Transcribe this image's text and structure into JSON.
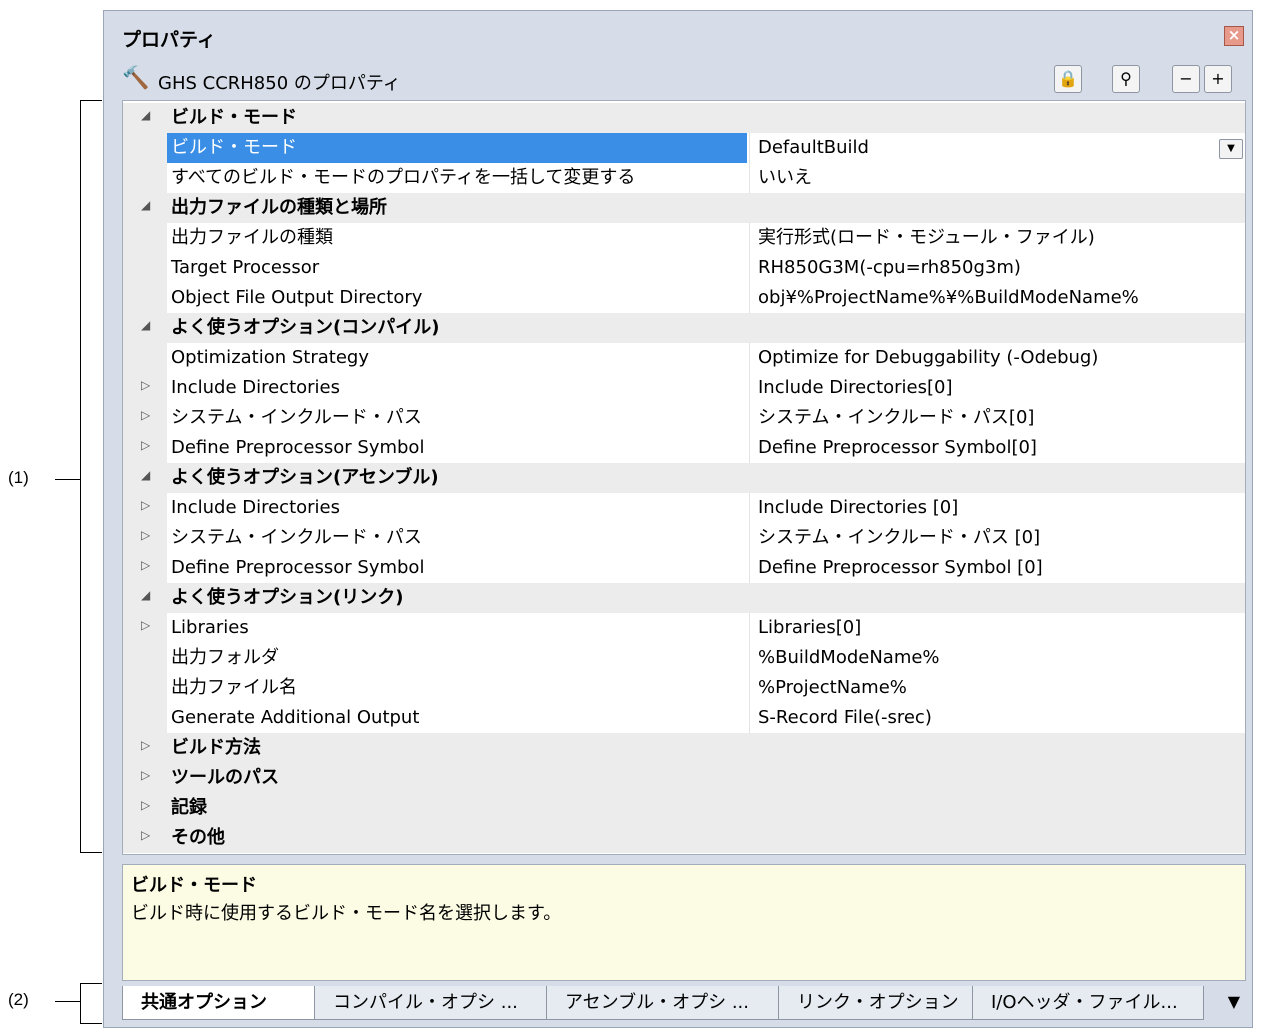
{
  "callouts": {
    "one": "(1)",
    "two": "(2)"
  },
  "window": {
    "title": "プロパティ"
  },
  "toolbar": {
    "title": "GHS CCRH850 のプロパティ"
  },
  "rows": [
    {
      "type": "cat",
      "expand": "open",
      "name": "ビルド・モード",
      "value": ""
    },
    {
      "type": "prop",
      "expand": "",
      "name": "ビルド・モード",
      "value": "DefaultBuild",
      "selected": true,
      "dropdown": true
    },
    {
      "type": "prop",
      "expand": "",
      "name": "すべてのビルド・モードのプロパティを一括して変更する",
      "value": "いいえ"
    },
    {
      "type": "cat",
      "expand": "open",
      "name": "出力ファイルの種類と場所",
      "value": ""
    },
    {
      "type": "prop",
      "expand": "",
      "name": "出力ファイルの種類",
      "value": "実行形式(ロード・モジュール・ファイル)"
    },
    {
      "type": "prop",
      "expand": "",
      "name": "Target Processor",
      "value": "RH850G3M(-cpu=rh850g3m)"
    },
    {
      "type": "prop",
      "expand": "",
      "name": "Object File Output Directory",
      "value": "obj¥%ProjectName%¥%BuildModeName%"
    },
    {
      "type": "cat",
      "expand": "open",
      "name": "よく使うオプション(コンパイル)",
      "value": ""
    },
    {
      "type": "prop",
      "expand": "",
      "name": "Optimization Strategy",
      "value": "Optimize for Debuggability (-Odebug)"
    },
    {
      "type": "prop",
      "expand": "closed",
      "name": "Include Directories",
      "value": "Include Directories[0]"
    },
    {
      "type": "prop",
      "expand": "closed",
      "name": "システム・インクルード・パス",
      "value": "システム・インクルード・パス[0]"
    },
    {
      "type": "prop",
      "expand": "closed",
      "name": "Define Preprocessor Symbol",
      "value": "Define Preprocessor Symbol[0]"
    },
    {
      "type": "cat",
      "expand": "open",
      "name": "よく使うオプション(アセンブル)",
      "value": ""
    },
    {
      "type": "prop",
      "expand": "closed",
      "name": "Include Directories",
      "value": "Include Directories [0]"
    },
    {
      "type": "prop",
      "expand": "closed",
      "name": "システム・インクルード・パス",
      "value": "システム・インクルード・パス [0]"
    },
    {
      "type": "prop",
      "expand": "closed",
      "name": "Define Preprocessor Symbol",
      "value": "Define Preprocessor Symbol [0]"
    },
    {
      "type": "cat",
      "expand": "open",
      "name": "よく使うオプション(リンク)",
      "value": ""
    },
    {
      "type": "prop",
      "expand": "closed",
      "name": "Libraries",
      "value": "Libraries[0]"
    },
    {
      "type": "prop",
      "expand": "",
      "name": "出力フォルダ",
      "value": "%BuildModeName%"
    },
    {
      "type": "prop",
      "expand": "",
      "name": "出力ファイル名",
      "value": "%ProjectName%"
    },
    {
      "type": "prop",
      "expand": "",
      "name": "Generate Additional Output",
      "value": "S-Record File(-srec)"
    },
    {
      "type": "cat",
      "expand": "closed",
      "name": "ビルド方法",
      "value": ""
    },
    {
      "type": "cat",
      "expand": "closed",
      "name": "ツールのパス",
      "value": ""
    },
    {
      "type": "cat",
      "expand": "closed",
      "name": "記録",
      "value": ""
    },
    {
      "type": "cat",
      "expand": "closed",
      "name": "その他",
      "value": ""
    }
  ],
  "description": {
    "title": "ビルド・モード",
    "text": "ビルド時に使用するビルド・モード名を選択します。"
  },
  "tabs": [
    {
      "label": "共通オプション",
      "active": true
    },
    {
      "label": "コンパイル・オプシ ...",
      "active": false
    },
    {
      "label": "アセンブル・オプシ ...",
      "active": false
    },
    {
      "label": "リンク・オプション",
      "active": false
    },
    {
      "label": "I/Oヘッダ・ファイル...",
      "active": false
    }
  ]
}
